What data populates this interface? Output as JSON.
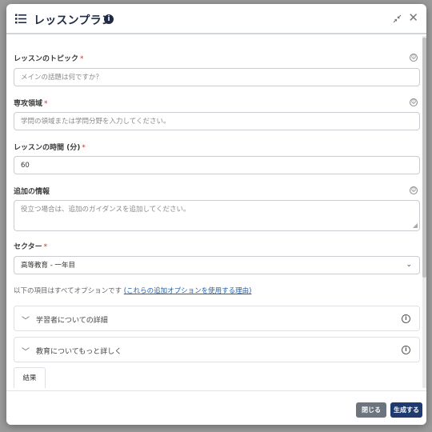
{
  "header": {
    "title": "レッスンプラン",
    "info_icon_glyph": "i"
  },
  "fields": {
    "topic": {
      "label": "レッスンのトピック",
      "required_mark": "*",
      "placeholder": "メインの話題は何ですか？"
    },
    "specialty": {
      "label": "専攻領域",
      "required_mark": "*",
      "placeholder": "学問の領域または学問分野を入力してください。"
    },
    "duration": {
      "label": "レッスンの時間 (分)",
      "required_mark": "*",
      "value": "60"
    },
    "additional": {
      "label": "追加の情報",
      "placeholder": "役立つ場合は、追加のガイダンスを追加してください。"
    },
    "sector": {
      "label": "セクター",
      "required_mark": "*",
      "selected": "高等教育 - 一年目"
    }
  },
  "optional_note": {
    "text": "以下の項目はすべてオプションです",
    "link": "(これらの追加オプションを使用する理由)"
  },
  "accordions": [
    {
      "label": "学習者についての詳細"
    },
    {
      "label": "教育についてもっと詳しく"
    }
  ],
  "tab": {
    "label": "結果"
  },
  "footer": {
    "close_label": "閉じる",
    "generate_label": "生成する"
  },
  "icons": {
    "list": "list-icon",
    "info": "info-icon",
    "collapse": "collapse-icon",
    "close": "close-icon",
    "help": "help-icon",
    "chevron": "chevron-down-icon"
  }
}
